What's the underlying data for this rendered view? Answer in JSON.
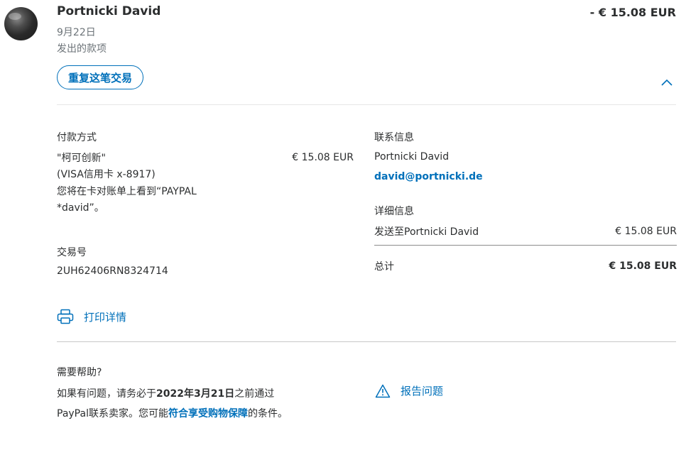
{
  "header": {
    "name": "Portnicki David",
    "date": "9月22日",
    "type": "发出的款项",
    "amount": "- € 15.08 EUR",
    "repeat_button": "重复这笔交易"
  },
  "payment": {
    "heading": "付款方式",
    "method_line1": "\"柯可创新\"",
    "method_line2": "(VISA信用卡 x-8917)",
    "method_line3": "您将在卡对账单上看到“PAYPAL",
    "method_line4": "*david”。",
    "method_amount": "€ 15.08 EUR"
  },
  "transaction": {
    "heading": "交易号",
    "id": "2UH62406RN8324714"
  },
  "contact": {
    "heading": "联系信息",
    "name": "Portnicki David",
    "email": "david@portnicki.de"
  },
  "details": {
    "heading": "详细信息",
    "line_label": "发送至Portnicki David",
    "line_amount": "€ 15.08 EUR",
    "total_label": "总计",
    "total_amount": "€ 15.08 EUR"
  },
  "print": {
    "label": "打印详情",
    "icon": "printer-icon"
  },
  "help": {
    "heading": "需要帮助?",
    "text_part1": "如果有问题，请务必于",
    "deadline": "2022年3月21日",
    "text_part2": "之前通过PayPal联系卖家。您可能",
    "protection_link": "符合享受购物保障",
    "text_part3": "的条件。"
  },
  "report": {
    "label": "报告问题",
    "icon": "warning-icon"
  },
  "colors": {
    "accent": "#0070ba",
    "text": "#2c2e2f",
    "muted": "#6c7378",
    "divider": "#e6e6e6"
  }
}
